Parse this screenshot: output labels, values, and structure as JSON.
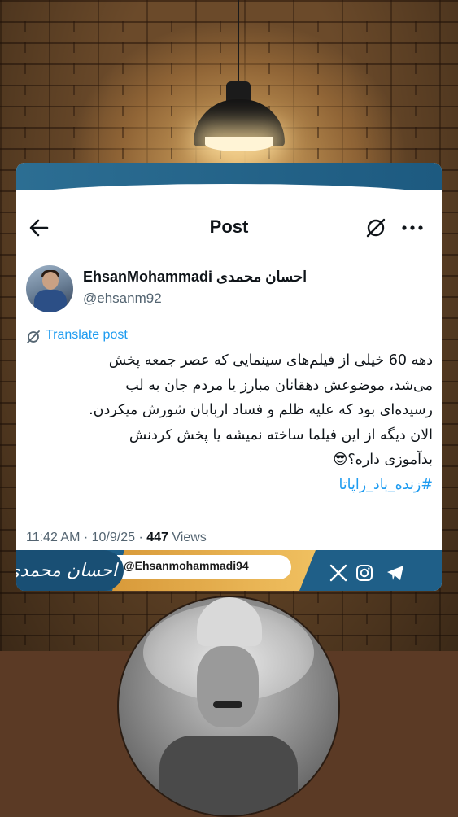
{
  "nav": {
    "title": "Post"
  },
  "author": {
    "name": "EhsanMohammadi احسان محمدی",
    "handle": "@ehsanm92"
  },
  "post": {
    "translate_label": "Translate post",
    "lines": [
      "دهه 60 خیلی از فیلم‌های سینمایی که عصر جمعه پخش",
      "می‌شد، موضوعش دهقانان مبارز یا مردم جان به لب",
      "رسیده‌ای بود که علیه ظلم و فساد اربابان شورش میکردن.",
      "الان دیگه از این فیلما ساخته نمیشه یا پخش کردنش",
      "بدآموزی داره؟😎"
    ],
    "hashtag": "#زنده_باد_زاپاتا",
    "time_date": "11:42 AM · 10/9/25 · ",
    "views_count": "447",
    "views_label": " Views"
  },
  "banner": {
    "handle": "@Ehsanmohammadi94",
    "logo_text": "احسان محمدی"
  },
  "colors": {
    "accent": "#1d9bf0",
    "banner_blue": "#1f5f88",
    "banner_gold": "#e0a848"
  },
  "icons": [
    "back-arrow-icon",
    "translate-icon",
    "more-icon",
    "x-logo-icon",
    "instagram-icon",
    "telegram-icon"
  ]
}
